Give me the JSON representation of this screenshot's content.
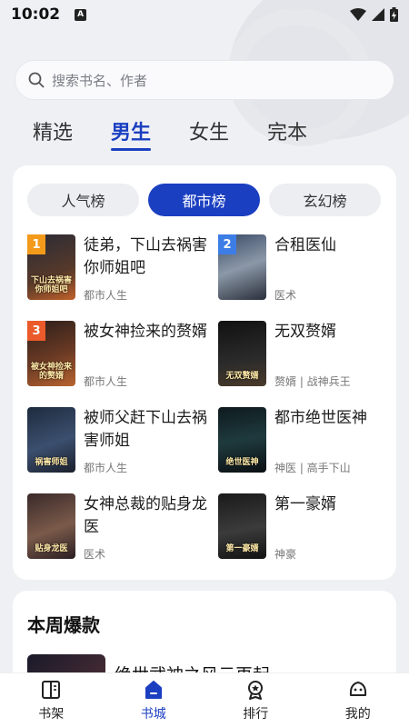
{
  "status": {
    "time": "10:02",
    "notif": "A"
  },
  "search": {
    "placeholder": "搜索书名、作者"
  },
  "top_tabs": [
    {
      "label": "精选",
      "active": false
    },
    {
      "label": "男生",
      "active": true
    },
    {
      "label": "女生",
      "active": false
    },
    {
      "label": "完本",
      "active": false
    }
  ],
  "ranking": {
    "segments": [
      {
        "label": "人气榜",
        "active": false
      },
      {
        "label": "都市榜",
        "active": true
      },
      {
        "label": "玄幻榜",
        "active": false
      }
    ],
    "books": [
      {
        "rank": "1",
        "title": "徒弟，下山去祸害你师姐吧",
        "tag": "都市人生",
        "cover_text": "下山去祸害你师姐吧",
        "badge_color": "#f39a1b"
      },
      {
        "rank": "2",
        "title": "合租医仙",
        "tag": "医术",
        "cover_text": "",
        "badge_color": "#3d7de6"
      },
      {
        "rank": "3",
        "title": "被女神捡来的赘婿",
        "tag": "都市人生",
        "cover_text": "被女神捡来的赘婿",
        "badge_color": "#ea5a2a"
      },
      {
        "rank": "",
        "title": "无双赘婿",
        "tag": "赘婿 | 战神兵王",
        "cover_text": "无双赘婿",
        "badge_color": ""
      },
      {
        "rank": "",
        "title": "被师父赶下山去祸害师姐",
        "tag": "都市人生",
        "cover_text": "祸害师姐",
        "badge_color": ""
      },
      {
        "rank": "",
        "title": "都市绝世医神",
        "tag": "神医 | 高手下山",
        "cover_text": "绝世医神",
        "badge_color": ""
      },
      {
        "rank": "",
        "title": "女神总裁的贴身龙医",
        "tag": "医术",
        "cover_text": "贴身龙医",
        "badge_color": ""
      },
      {
        "rank": "",
        "title": "第一豪婿",
        "tag": "神豪",
        "cover_text": "第一豪婿",
        "badge_color": ""
      }
    ]
  },
  "weekly": {
    "title": "本周爆款",
    "first_book": "绝世武神之风云再起"
  },
  "bottom_nav": [
    {
      "label": "书架",
      "icon": "bookshelf-icon",
      "active": false
    },
    {
      "label": "书城",
      "icon": "bookstore-icon",
      "active": true
    },
    {
      "label": "排行",
      "icon": "ranking-medal-icon",
      "active": false
    },
    {
      "label": "我的",
      "icon": "profile-face-icon",
      "active": false
    }
  ],
  "colors": {
    "accent": "#1b3fc1"
  }
}
